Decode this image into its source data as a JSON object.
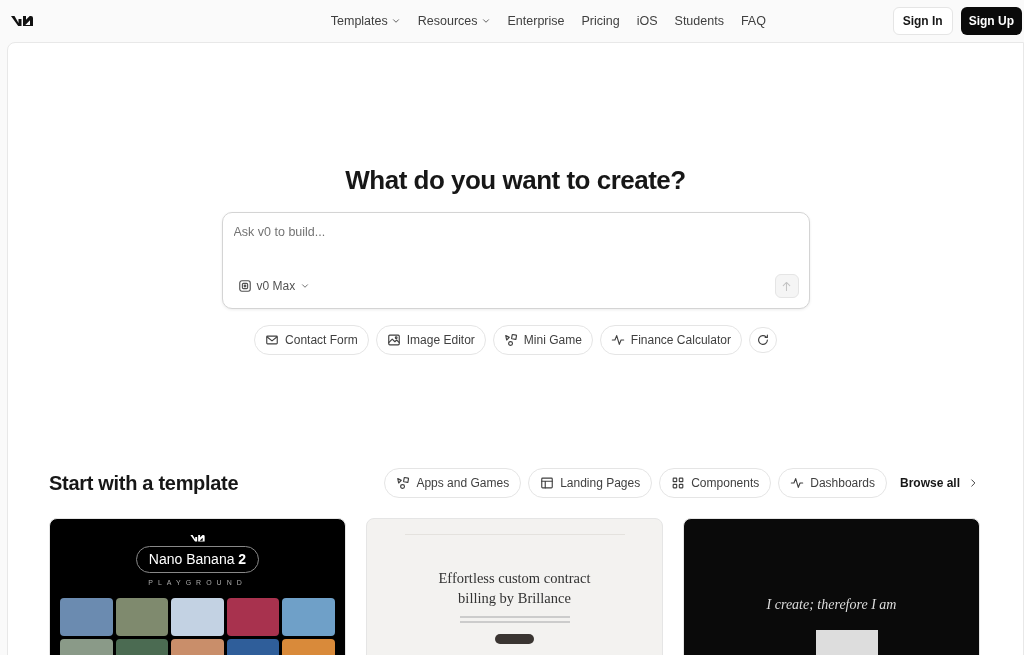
{
  "nav": {
    "links": [
      {
        "label": "Templates",
        "dropdown": true
      },
      {
        "label": "Resources",
        "dropdown": true
      },
      {
        "label": "Enterprise",
        "dropdown": false
      },
      {
        "label": "Pricing",
        "dropdown": false
      },
      {
        "label": "iOS",
        "dropdown": false
      },
      {
        "label": "Students",
        "dropdown": false
      },
      {
        "label": "FAQ",
        "dropdown": false
      }
    ],
    "sign_in": "Sign In",
    "sign_up": "Sign Up"
  },
  "hero": {
    "title": "What do you want to create?",
    "prompt": {
      "placeholder": "Ask v0 to build...",
      "model": "v0 Max",
      "send_disabled": true
    },
    "suggestions": [
      "Contact Form",
      "Image Editor",
      "Mini Game",
      "Finance Calculator"
    ]
  },
  "templates": {
    "title": "Start with a template",
    "filters": [
      "Apps and Games",
      "Landing Pages",
      "Components",
      "Dashboards"
    ],
    "browse_all": "Browse all",
    "cards": [
      {
        "kind": "playground",
        "badge": "Nano Banana **2**",
        "subtitle": "PLAYGROUND"
      },
      {
        "kind": "landing",
        "headline": "Effortless custom contract billing by Brillance"
      },
      {
        "kind": "dark",
        "headline": "I create; therefore I am"
      }
    ]
  }
}
